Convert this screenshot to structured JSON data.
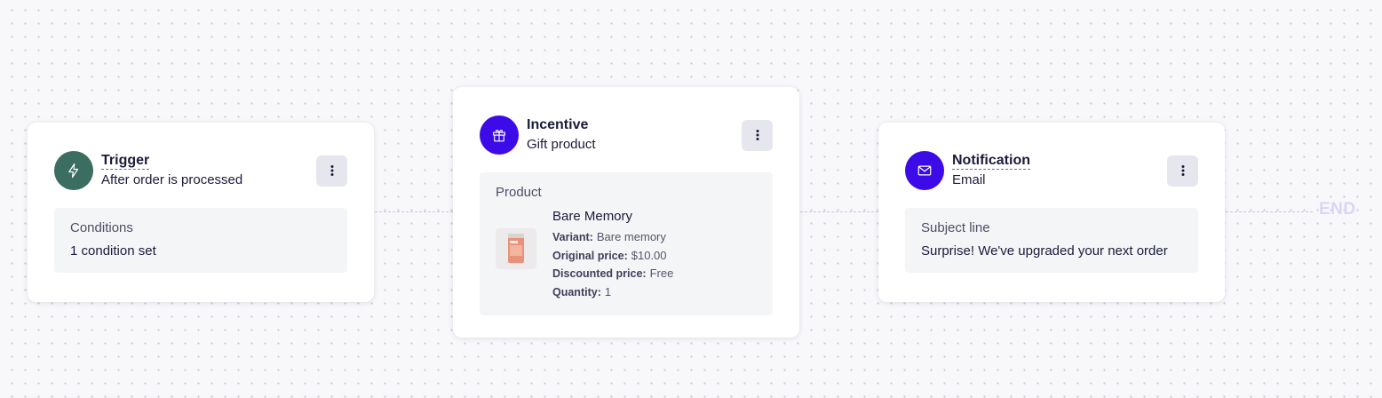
{
  "trigger": {
    "title": "Trigger",
    "subtitle": "After order is processed",
    "panel_label": "Conditions",
    "panel_value": "1 condition set",
    "icon": "lightning-icon",
    "icon_color": "#3b6e60"
  },
  "incentive": {
    "title": "Incentive",
    "subtitle": "Gift product",
    "panel_label": "Product",
    "icon": "gift-icon",
    "icon_color": "#3c0be8",
    "product": {
      "name": "Bare Memory",
      "variant_label": "Variant:",
      "variant_value": "Bare memory",
      "original_price_label": "Original price:",
      "original_price_value": "$10.00",
      "discounted_price_label": "Discounted price:",
      "discounted_price_value": "Free",
      "quantity_label": "Quantity:",
      "quantity_value": "1"
    }
  },
  "notification": {
    "title": "Notification",
    "subtitle": "Email",
    "panel_label": "Subject line",
    "panel_value": "Surprise! We've upgraded your next order",
    "icon": "envelope-icon",
    "icon_color": "#3c0be8"
  },
  "flow_end_label": "END",
  "menu_icon": "kebab-menu-icon"
}
